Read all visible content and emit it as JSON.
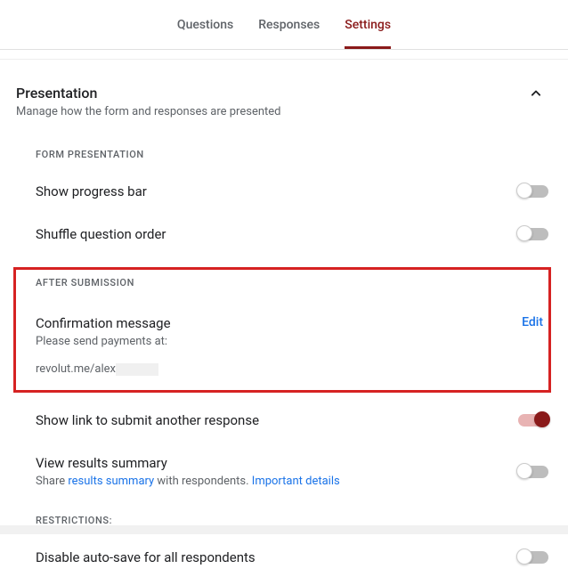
{
  "tabs": {
    "questions": "Questions",
    "responses": "Responses",
    "settings": "Settings"
  },
  "section": {
    "title": "Presentation",
    "desc": "Manage how the form and responses are presented"
  },
  "form_presentation": {
    "label": "FORM PRESENTATION",
    "progress": "Show progress bar",
    "shuffle": "Shuffle question order"
  },
  "after_submission": {
    "label": "AFTER SUBMISSION",
    "confirm_title": "Confirmation message",
    "confirm_line1": "Please send payments at:",
    "confirm_line2": "revolut.me/alex",
    "edit": "Edit"
  },
  "submit_another": "Show link to submit another response",
  "results": {
    "title": "View results summary",
    "share_prefix": "Share ",
    "results_summary": "results summary",
    "share_suffix": " with respondents. ",
    "details": "Important details"
  },
  "restrictions": {
    "label": "RESTRICTIONS:",
    "autosave": "Disable auto-save for all respondents"
  }
}
